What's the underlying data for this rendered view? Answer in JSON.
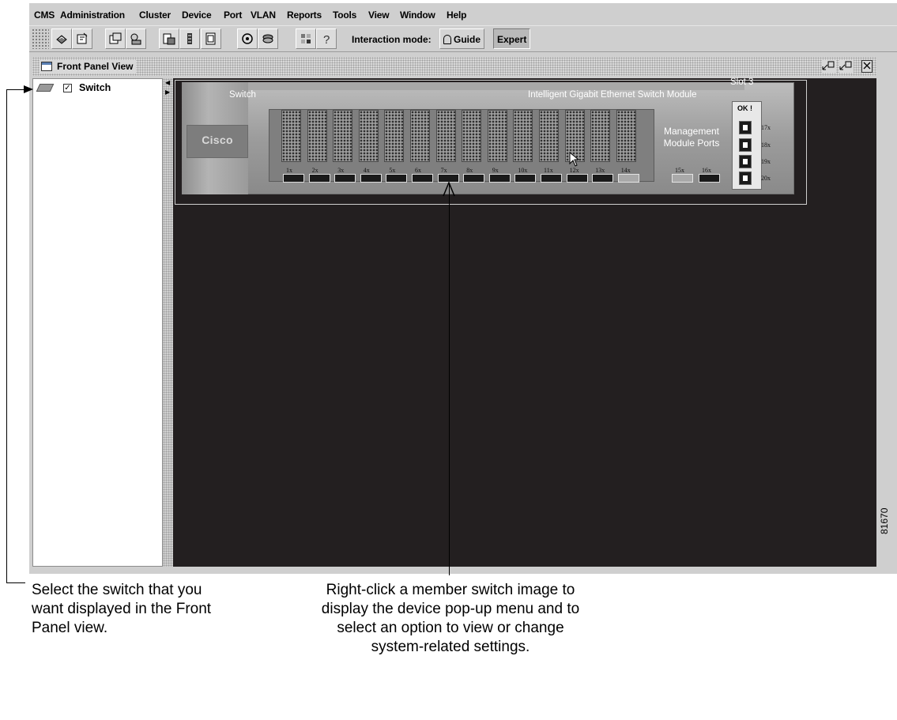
{
  "menubar": {
    "items": [
      "CMS",
      "Administration",
      "Cluster",
      "Device",
      "Port",
      "VLAN",
      "Reports",
      "Tools",
      "View",
      "Window",
      "Help"
    ]
  },
  "toolbar": {
    "icons": [
      "printer-icon",
      "document-icon",
      "window-icon",
      "settings-icon",
      "export-icon",
      "column-icon",
      "page-icon",
      "refresh-icon",
      "stack-icon",
      "grid-icon",
      "help-icon"
    ],
    "interaction_mode_label": "Interaction mode:",
    "guide_label": "Guide",
    "expert_label": "Expert",
    "active_mode": "Expert"
  },
  "front_panel_window": {
    "title": "Front Panel View",
    "controls": [
      "restore",
      "minimize",
      "close"
    ]
  },
  "tree": {
    "node_label": "Switch",
    "checked": true
  },
  "switch_view": {
    "label": "Switch",
    "module_name": "Intelligent Gigabit Ethernet Switch Module",
    "slot": "Slot 3",
    "logo_text": "Cisco",
    "port_labels": [
      "1x",
      "2x",
      "3x",
      "4x",
      "5x",
      "6x",
      "7x",
      "8x",
      "9x",
      "10x",
      "11x",
      "12x",
      "13x",
      "14x"
    ],
    "management_text": "Management Module Ports",
    "management_port_labels": [
      "15x",
      "16x"
    ],
    "status_text": "OK !",
    "uplink_port_labels": [
      "17x",
      "18x",
      "19x",
      "20x"
    ]
  },
  "callouts": {
    "left": "Select the switch that you want displayed in the Front Panel view.",
    "center": "Right-click a member switch image to display the device pop-up menu and to select an option to view or change system-related settings."
  },
  "figure_number": "81670"
}
